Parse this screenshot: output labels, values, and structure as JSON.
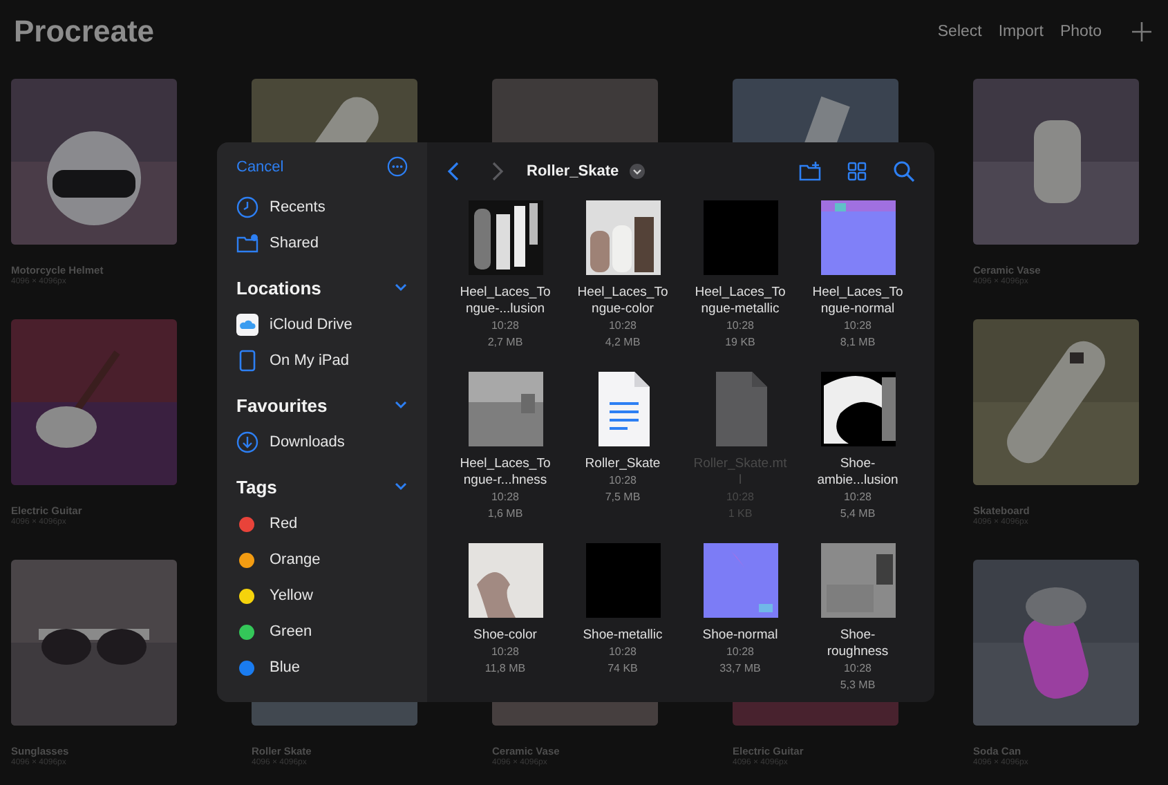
{
  "header": {
    "title": "Procreate",
    "actions": [
      "Select",
      "Import",
      "Photo"
    ]
  },
  "gallery": [
    [
      {
        "kind": "picture",
        "title": "Motorcycle Helmet",
        "size": "4096 × 4096px"
      },
      {
        "kind": "picture"
      },
      {
        "kind": "picture"
      },
      {
        "kind": "picture"
      },
      {
        "kind": "picture",
        "title": "Ceramic Vase",
        "size": "4096 × 4096px"
      }
    ],
    [
      {
        "kind": "picture",
        "title": "Electric Guitar",
        "size": "4096 × 4096px"
      },
      {
        "kind": "picture",
        "title": "Skateboard",
        "size": "4096 × 4096px"
      }
    ],
    [
      {
        "kind": "picture",
        "title": "Sunglasses",
        "size": "4096 × 4096px"
      },
      {
        "kind": "picture",
        "title": "Roller Skate",
        "size": "4096 × 4096px"
      },
      {
        "kind": "picture",
        "title": "Ceramic Vase",
        "size": "4096 × 4096px"
      },
      {
        "kind": "picture",
        "title": "Electric Guitar",
        "size": "4096 × 4096px"
      },
      {
        "kind": "picture",
        "title": "Soda Can",
        "size": "4096 × 4096px"
      }
    ]
  ],
  "picker": {
    "cancel": "Cancel",
    "folder": "Roller_Skate",
    "sidebar": {
      "top": [
        {
          "kind": "recents",
          "label": "Recents"
        },
        {
          "kind": "shared",
          "label": "Shared"
        }
      ],
      "sections": [
        {
          "title": "Locations",
          "expanded": true,
          "items": [
            {
              "kind": "icloud",
              "label": "iCloud Drive"
            },
            {
              "kind": "ipad",
              "label": "On My iPad"
            }
          ]
        },
        {
          "title": "Favourites",
          "expanded": true,
          "items": [
            {
              "kind": "downloads",
              "label": "Downloads"
            }
          ]
        },
        {
          "title": "Tags",
          "expanded": true,
          "items": [
            {
              "kind": "tag",
              "label": "Red",
              "color": "#e8433a"
            },
            {
              "kind": "tag",
              "label": "Orange",
              "color": "#f39c12"
            },
            {
              "kind": "tag",
              "label": "Yellow",
              "color": "#f5d30c"
            },
            {
              "kind": "tag",
              "label": "Green",
              "color": "#34c759"
            },
            {
              "kind": "tag",
              "label": "Blue",
              "color": "#1a7cf0"
            }
          ]
        }
      ]
    },
    "files": [
      {
        "kind": "picture",
        "name": "Heel_Laces_Tongue-...lusion",
        "time": "10:28",
        "size": "2,7 MB",
        "disabled": false
      },
      {
        "kind": "picture",
        "name": "Heel_Laces_Tongue-color",
        "time": "10:28",
        "size": "4,2 MB",
        "disabled": false
      },
      {
        "kind": "picture",
        "name": "Heel_Laces_Tongue-metallic",
        "time": "10:28",
        "size": "19 KB",
        "disabled": false
      },
      {
        "kind": "picture",
        "name": "Heel_Laces_Tongue-normal",
        "time": "10:28",
        "size": "8,1 MB",
        "disabled": false
      },
      {
        "kind": "picture",
        "name": "Heel_Laces_Tongue-r...hness",
        "time": "10:28",
        "size": "1,6 MB",
        "disabled": false
      },
      {
        "kind": "document",
        "name": "Roller_Skate",
        "time": "10:28",
        "size": "7,5 MB",
        "disabled": false
      },
      {
        "kind": "file",
        "name": "Roller_Skate.mtl",
        "time": "10:28",
        "size": "1 KB",
        "disabled": true
      },
      {
        "kind": "picture",
        "name": "Shoe-ambie...lusion",
        "time": "10:28",
        "size": "5,4 MB",
        "disabled": false
      },
      {
        "kind": "picture",
        "name": "Shoe-color",
        "time": "10:28",
        "size": "11,8 MB",
        "disabled": false
      },
      {
        "kind": "picture",
        "name": "Shoe-metallic",
        "time": "10:28",
        "size": "74 KB",
        "disabled": false
      },
      {
        "kind": "picture",
        "name": "Shoe-normal",
        "time": "10:28",
        "size": "33,7 MB",
        "disabled": false
      },
      {
        "kind": "picture",
        "name": "Shoe-roughness",
        "time": "10:28",
        "size": "5,3 MB",
        "disabled": false
      }
    ]
  }
}
